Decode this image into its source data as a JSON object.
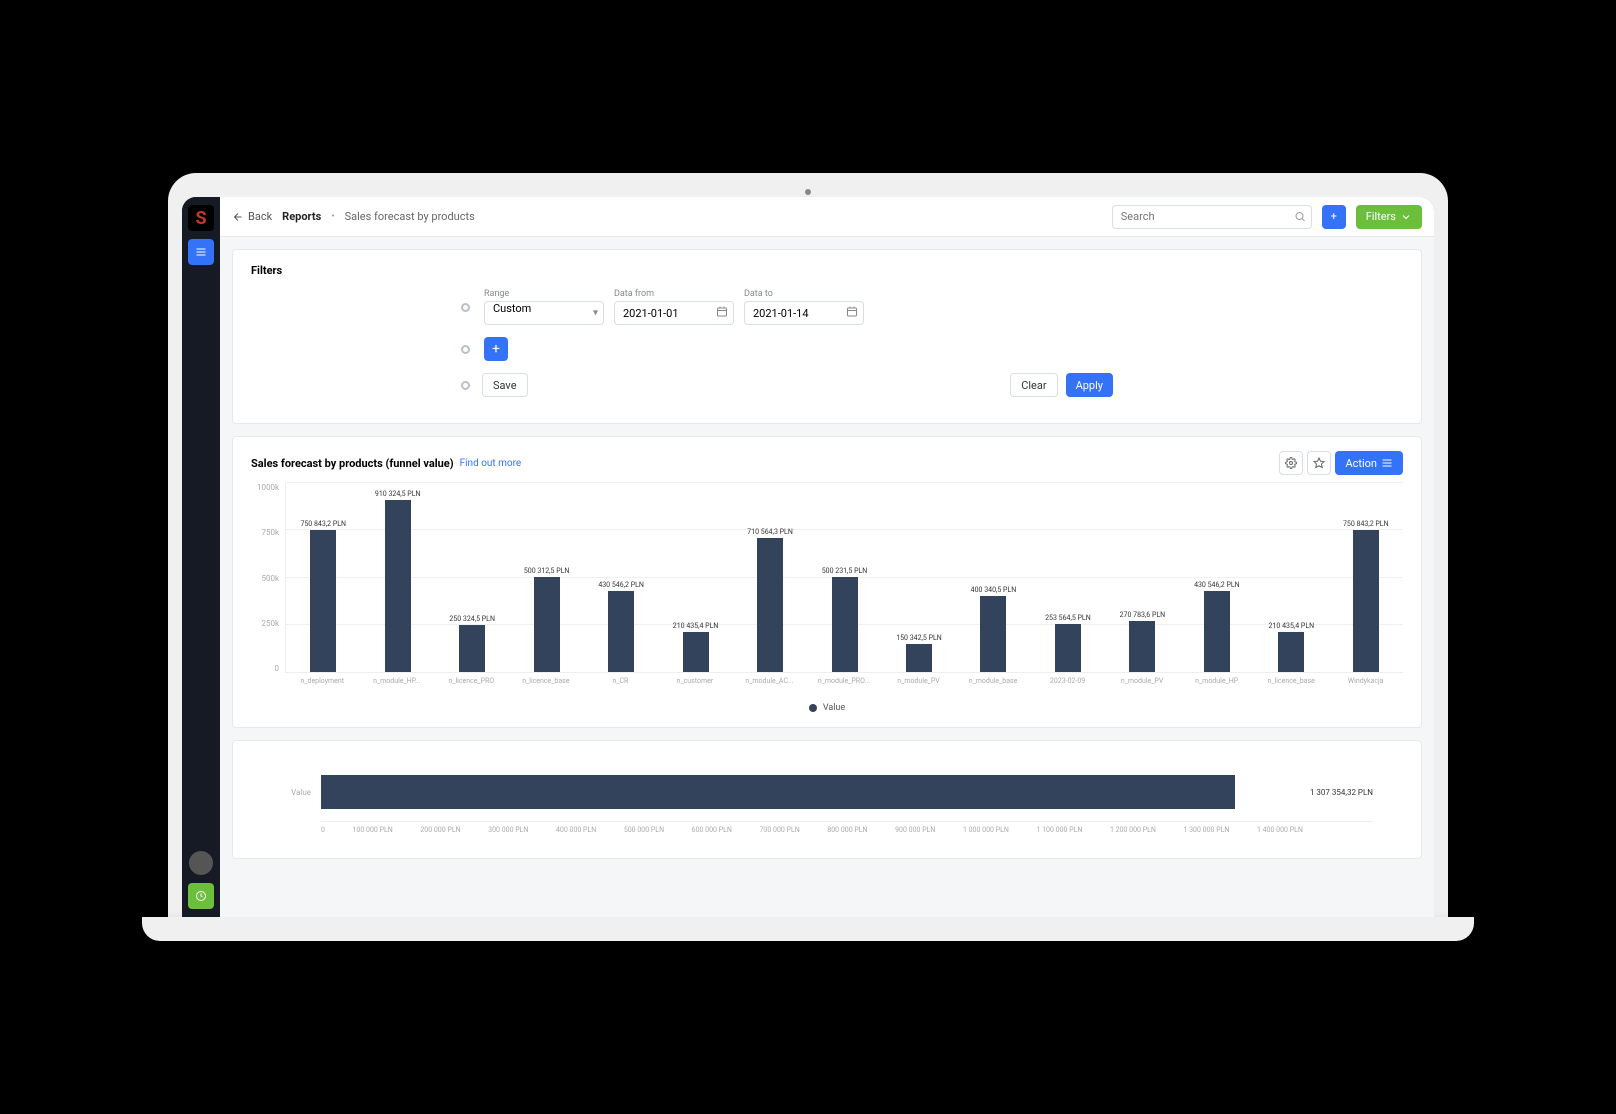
{
  "sidebar": {
    "logo_letter": "S"
  },
  "topbar": {
    "back_label": "Back",
    "breadcrumb_main": "Reports",
    "breadcrumb_sub": "Sales forecast by products",
    "search_placeholder": "Search",
    "filters_button": "Filters"
  },
  "filters": {
    "title": "Filters",
    "range_label": "Range",
    "range_value": "Custom",
    "date_from_label": "Data from",
    "date_from_value": "2021-01-01",
    "date_to_label": "Data to",
    "date_to_value": "2021-01-14",
    "save_label": "Save",
    "clear_label": "Clear",
    "apply_label": "Apply"
  },
  "chart": {
    "title": "Sales forecast by products (funnel value)",
    "link": "Find out more",
    "action_label": "Action",
    "legend_label": "Value",
    "y_ticks": [
      "1000k",
      "750k",
      "500k",
      "250k",
      "0"
    ]
  },
  "chart_data": {
    "type": "bar",
    "ylabel": "Value",
    "ylim": [
      0,
      1000000
    ],
    "unit": "PLN",
    "categories": [
      "n_deployment",
      "n_module_HP...",
      "n_licence_PRO",
      "n_licence_base",
      "n_CR",
      "n_customer",
      "n_module_AC...",
      "n_module_PRO...",
      "n_module_PV",
      "n_module_base",
      "2023-02-09",
      "n_module_PV",
      "n_module_HP",
      "n_licence_base",
      "Windykacja"
    ],
    "values": [
      750843.2,
      910324.5,
      250324.5,
      500312.5,
      430546.2,
      210435.4,
      710564.3,
      500231.5,
      150342.5,
      400340.5,
      253564.5,
      270783.6,
      430546.2,
      210435.4,
      750843.2
    ],
    "labels": [
      "750 843,2 PLN",
      "910 324,5 PLN",
      "250 324,5 PLN",
      "500 312,5 PLN",
      "430 546,2 PLN",
      "210 435,4 PLN",
      "710 564,3 PLN",
      "500 231,5 PLN",
      "150 342,5 PLN",
      "400 340,5 PLN",
      "253 564,5 PLN",
      "270 783,6 PLN",
      "430 546,2 PLN",
      "210 435,4 PLN",
      "750 843,2 PLN"
    ]
  },
  "hchart": {
    "ylabel": "Value",
    "value_label": "1 307 354,32 PLN",
    "x_ticks": [
      "0",
      "100 000 PLN",
      "200 000 PLN",
      "300 000 PLN",
      "400 000 PLN",
      "500 000 PLN",
      "600 000 PLN",
      "700 000 PLN",
      "800 000 PLN",
      "900 000 PLN",
      "1 000 000 PLN",
      "1 100 000 PLN",
      "1 200 000 PLN",
      "1 300 000 PLN",
      "1 400 000 PLN"
    ]
  },
  "hchart_data": {
    "type": "bar",
    "orientation": "horizontal",
    "categories": [
      "Value"
    ],
    "values": [
      1307354.32
    ],
    "xlim": [
      0,
      1400000
    ],
    "unit": "PLN"
  }
}
